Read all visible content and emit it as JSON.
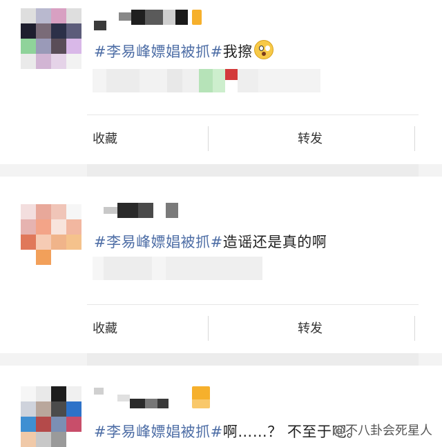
{
  "posts": [
    {
      "content_prefix": "#李易峰嫖娼被抓#",
      "content_suffix": "我擦",
      "emoji": "astonished-face",
      "actions": {
        "collect": "收藏",
        "forward": "转发"
      }
    },
    {
      "content_prefix": "#李易峰嫖娼被抓#",
      "content_suffix": "造谣还是真的啊",
      "actions": {
        "collect": "收藏",
        "forward": "转发"
      }
    },
    {
      "content_prefix": "#李易峰嫖娼被抓#",
      "content_suffix": "啊……？ 不至于吧。"
    }
  ],
  "watermark": "@不八卦会死星人",
  "colors": {
    "hashtag": "#4e6ea6",
    "badge": "#f6b02c",
    "divider": "#d8d8d8"
  }
}
